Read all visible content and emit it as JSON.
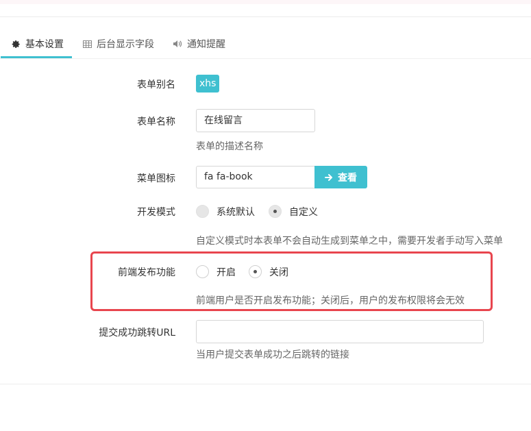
{
  "tabs": [
    {
      "label": "基本设置",
      "icon": "gear-icon",
      "active": true
    },
    {
      "label": "后台显示字段",
      "icon": "table-icon",
      "active": false
    },
    {
      "label": "通知提醒",
      "icon": "volume-icon",
      "active": false
    }
  ],
  "form": {
    "alias": {
      "label": "表单别名",
      "value": "xhs"
    },
    "name": {
      "label": "表单名称",
      "value": "在线留言",
      "help": "表单的描述名称"
    },
    "menu_icon": {
      "label": "菜单图标",
      "value": "fa fa-book",
      "button": "查看"
    },
    "dev_mode": {
      "label": "开发模式",
      "options": [
        "系统默认",
        "自定义"
      ],
      "selected": "自定义",
      "help": "自定义模式时本表单不会自动生成到菜单之中，需要开发者手动写入菜单"
    },
    "frontend_publish": {
      "label": "前端发布功能",
      "options": [
        "开启",
        "关闭"
      ],
      "selected": "关闭",
      "help": "前端用户是否开启发布功能；关闭后，用户的发布权限将会无效"
    },
    "redirect_url": {
      "label": "提交成功跳转URL",
      "value": "",
      "help": "当用户提交表单成功之后跳转的链接"
    }
  },
  "colors": {
    "accent": "#3fc0d0",
    "highlight": "#e8454e"
  }
}
